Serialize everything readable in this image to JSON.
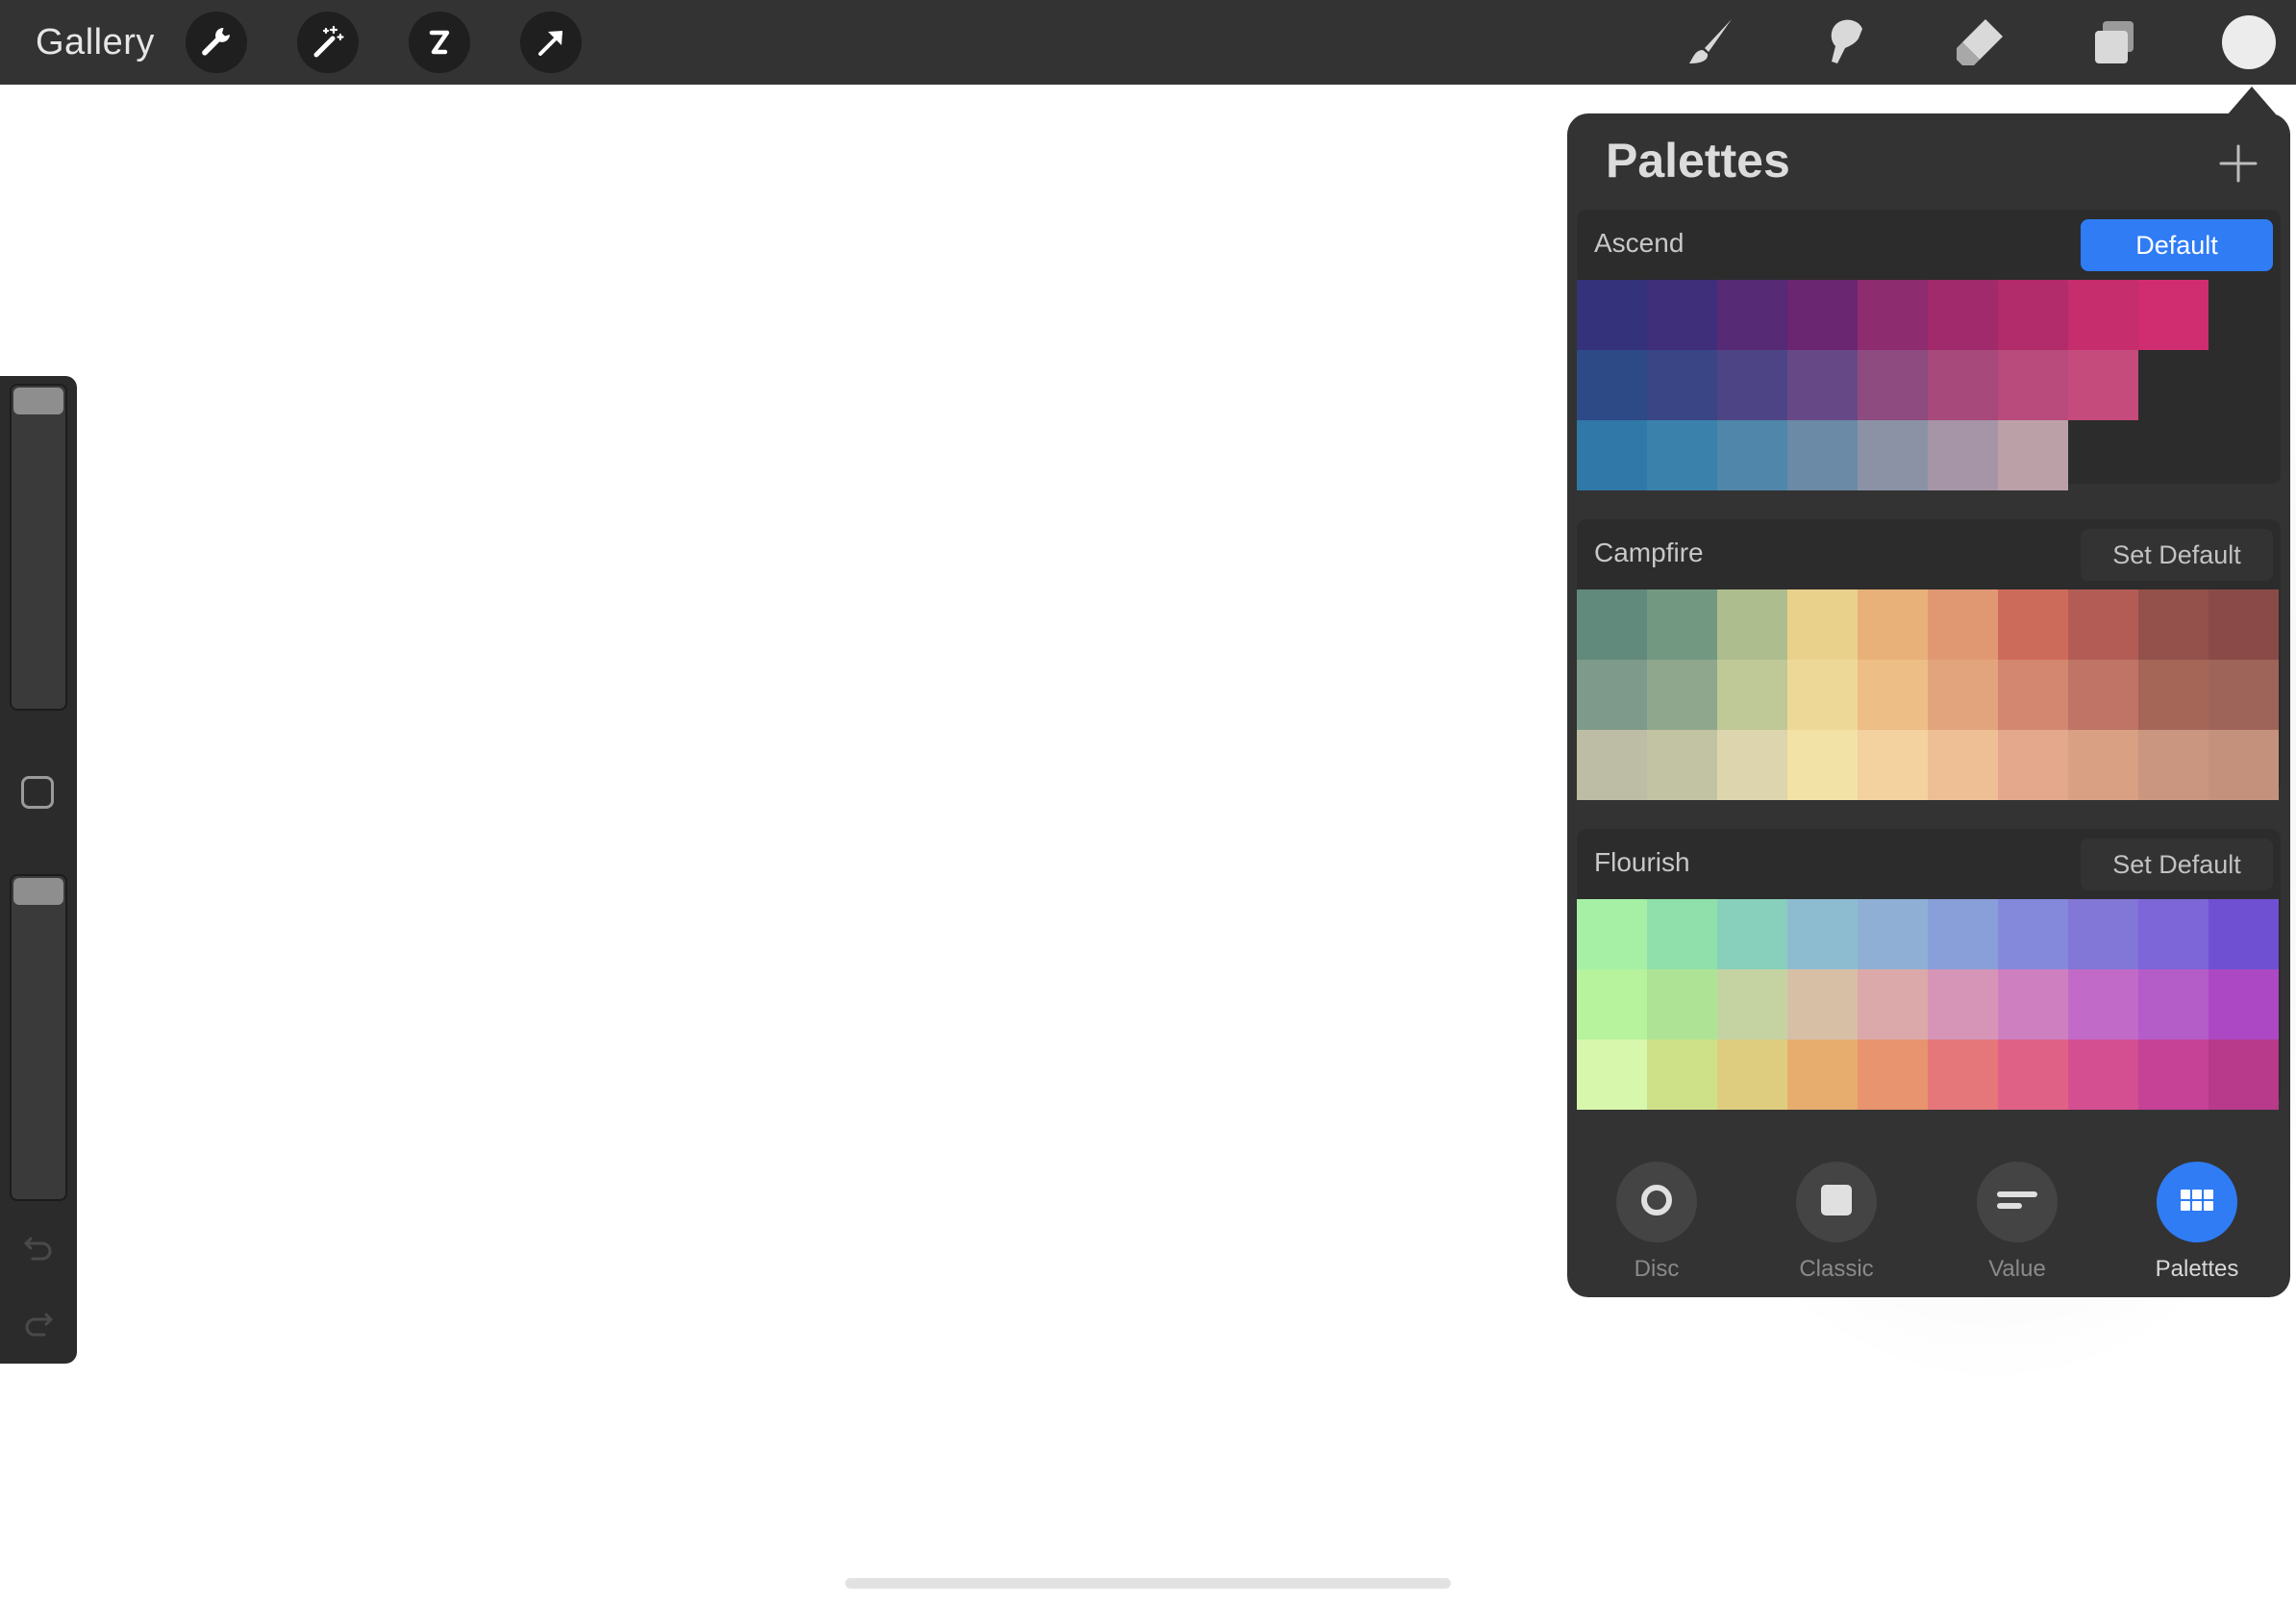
{
  "toolbar": {
    "gallery_label": "Gallery",
    "left_icons": [
      "wrench-icon",
      "magic-wand-icon",
      "selection-icon",
      "transform-arrow-icon"
    ],
    "right_icons": [
      "brush-icon",
      "smudge-icon",
      "eraser-icon",
      "layers-icon"
    ],
    "current_color": "#ececec"
  },
  "panel": {
    "title": "Palettes",
    "palettes": [
      {
        "name": "Ascend",
        "button": "Default",
        "is_default": true,
        "rows": [
          [
            "#34327a",
            "#3f2e79",
            "#562a74",
            "#6a2670",
            "#8d2c6e",
            "#a02a6b",
            "#b22b6a",
            "#c52d6c",
            "#d02d70",
            null
          ],
          [
            "#2e4a86",
            "#394585",
            "#4d4485",
            "#674886",
            "#8d4b80",
            "#a7497b",
            "#b94a7c",
            "#c54b7d",
            null,
            null
          ],
          [
            "#2f78a8",
            "#3a82ab",
            "#5086aa",
            "#6a8aa6",
            "#8c92a6",
            "#a695a6",
            "#bca0a8",
            null,
            null,
            null
          ]
        ]
      },
      {
        "name": "Campfire",
        "button": "Set Default",
        "is_default": false,
        "rows": [
          [
            "#628a7c",
            "#739882",
            "#aebd8e",
            "#e9d18c",
            "#e8b179",
            "#e09872",
            "#cd6b5b",
            "#b25c55",
            "#94504b",
            "#8a4a48"
          ],
          [
            "#7e9a8a",
            "#8fa78d",
            "#bfc897",
            "#edd898",
            "#edbe86",
            "#e2a47d",
            "#d38670",
            "#bf7465",
            "#a56658",
            "#9f6459"
          ],
          [
            "#bdbda5",
            "#c2c3a2",
            "#ddd5ad",
            "#f2e2a6",
            "#f3d29f",
            "#eebf94",
            "#e4a88d",
            "#d9a084",
            "#ca967f",
            "#c4927c"
          ]
        ]
      },
      {
        "name": "Flourish",
        "button": "Set Default",
        "is_default": false,
        "rows": [
          [
            "#a6f0a6",
            "#8fe0aa",
            "#88cfbc",
            "#8dbcd0",
            "#8fb0d4",
            "#889fd9",
            "#8489db",
            "#8276d7",
            "#7d66d8",
            "#7050d2"
          ],
          [
            "#b6f39c",
            "#aee396",
            "#c5d3a3",
            "#d7bfa6",
            "#dba9a9",
            "#d695b7",
            "#ce7fc0",
            "#c26ac8",
            "#b45cc8",
            "#ad48c4"
          ],
          [
            "#d7f7ad",
            "#cfe188",
            "#dfcd7f",
            "#e6ad6e",
            "#e8946f",
            "#e5777b",
            "#df6286",
            "#d44f92",
            "#c54297",
            "#b73a8b"
          ]
        ]
      }
    ],
    "tabs": [
      {
        "label": "Disc",
        "icon": "disc-icon"
      },
      {
        "label": "Classic",
        "icon": "classic-square-icon"
      },
      {
        "label": "Value",
        "icon": "value-sliders-icon"
      },
      {
        "label": "Palettes",
        "icon": "palettes-grid-icon",
        "active": true
      }
    ]
  }
}
